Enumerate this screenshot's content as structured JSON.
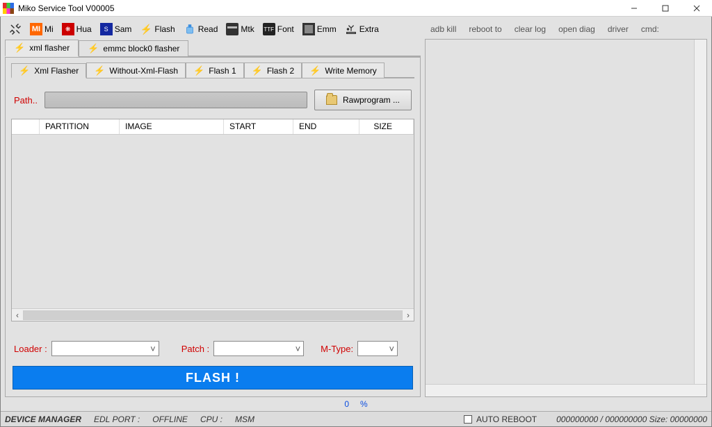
{
  "window": {
    "title": "Miko Service Tool V00005"
  },
  "main_toolbar": {
    "items": [
      {
        "label": ""
      },
      {
        "label": "Mi"
      },
      {
        "label": "Hua"
      },
      {
        "label": "Sam"
      },
      {
        "label": "Flash"
      },
      {
        "label": "Read"
      },
      {
        "label": "Mtk"
      },
      {
        "label": "Font"
      },
      {
        "label": "Emm"
      },
      {
        "label": "Extra"
      }
    ]
  },
  "right_links": {
    "items": [
      "adb kill",
      "reboot to",
      "clear log",
      "open diag",
      "driver",
      "cmd:"
    ]
  },
  "flasher_tabs": {
    "items": [
      "xml flasher",
      "emmc block0 flasher"
    ]
  },
  "sub_tabs": {
    "items": [
      "Xml Flasher",
      "Without-Xml-Flash",
      "Flash 1",
      "Flash 2",
      "Write Memory"
    ]
  },
  "path_row": {
    "label": "Path..",
    "value": "",
    "button": "Rawprogram ..."
  },
  "table": {
    "headers": [
      "",
      "PARTITION",
      "IMAGE",
      "START",
      "END",
      "SIZE"
    ]
  },
  "loader_row": {
    "loader_label": "Loader :",
    "loader_value": "",
    "patch_label": "Patch :",
    "patch_value": "",
    "mtype_label": "M-Type:",
    "mtype_value": ""
  },
  "flash_button": "FLASH !",
  "mid_status": {
    "a": "0",
    "b": "%"
  },
  "statusbar": {
    "device_manager": "DEVICE MANAGER",
    "edl_port_label": "EDL PORT :",
    "edl_port_value": "OFFLINE",
    "cpu_label": "CPU :",
    "cpu_value": "MSM",
    "auto_reboot": "AUTO REBOOT",
    "sizes": "000000000 / 000000000 Size: 00000000"
  }
}
